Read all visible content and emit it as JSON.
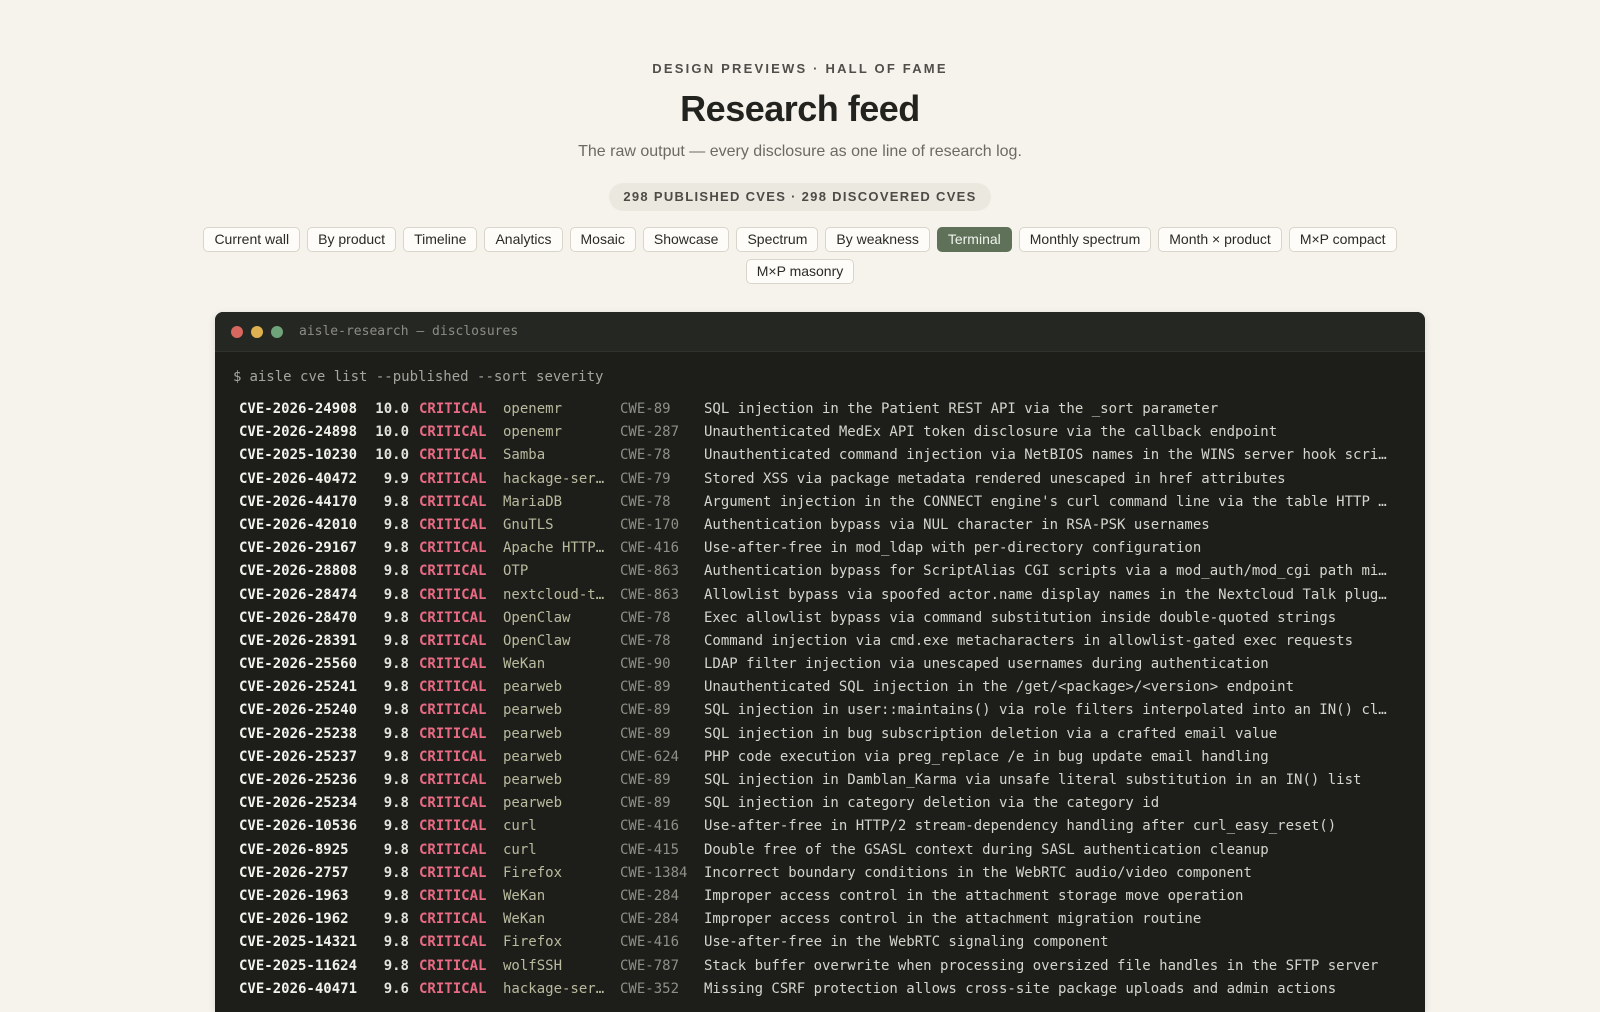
{
  "header": {
    "eyebrow": "DESIGN PREVIEWS · HALL OF FAME",
    "title": "Research feed",
    "subtitle": "The raw output — every disclosure as one line of research log.",
    "count_pill": "298 PUBLISHED CVES · 298 DISCOVERED CVES"
  },
  "nav": {
    "tabs": [
      {
        "label": "Current wall",
        "active": false
      },
      {
        "label": "By product",
        "active": false
      },
      {
        "label": "Timeline",
        "active": false
      },
      {
        "label": "Analytics",
        "active": false
      },
      {
        "label": "Mosaic",
        "active": false
      },
      {
        "label": "Showcase",
        "active": false
      },
      {
        "label": "Spectrum",
        "active": false
      },
      {
        "label": "By weakness",
        "active": false
      },
      {
        "label": "Terminal",
        "active": true
      },
      {
        "label": "Monthly spectrum",
        "active": false
      },
      {
        "label": "Month × product",
        "active": false
      },
      {
        "label": "M×P compact",
        "active": false
      },
      {
        "label": "M×P masonry",
        "active": false
      }
    ]
  },
  "terminal": {
    "title": "aisle-research — disclosures",
    "prompt": "$",
    "command": "aisle cve list --published --sort severity",
    "rows": [
      {
        "id": "CVE-2026-24908",
        "score": "10.0",
        "severity": "CRITICAL",
        "product": "openemr",
        "cwe": "CWE-89",
        "desc": "SQL injection in the Patient REST API via the _sort parameter"
      },
      {
        "id": "CVE-2026-24898",
        "score": "10.0",
        "severity": "CRITICAL",
        "product": "openemr",
        "cwe": "CWE-287",
        "desc": "Unauthenticated MedEx API token disclosure via the callback endpoint"
      },
      {
        "id": "CVE-2025-10230",
        "score": "10.0",
        "severity": "CRITICAL",
        "product": "Samba",
        "cwe": "CWE-78",
        "desc": "Unauthenticated command injection via NetBIOS names in the WINS server hook script"
      },
      {
        "id": "CVE-2026-40472",
        "score": "9.9",
        "severity": "CRITICAL",
        "product": "hackage-serv…",
        "cwe": "CWE-79",
        "desc": "Stored XSS via package metadata rendered unescaped in href attributes"
      },
      {
        "id": "CVE-2026-44170",
        "score": "9.8",
        "severity": "CRITICAL",
        "product": "MariaDB",
        "cwe": "CWE-78",
        "desc": "Argument injection in the CONNECT engine's curl command line via the table HTTP att…"
      },
      {
        "id": "CVE-2026-42010",
        "score": "9.8",
        "severity": "CRITICAL",
        "product": "GnuTLS",
        "cwe": "CWE-170",
        "desc": "Authentication bypass via NUL character in RSA-PSK usernames"
      },
      {
        "id": "CVE-2026-29167",
        "score": "9.8",
        "severity": "CRITICAL",
        "product": "Apache HTTP …",
        "cwe": "CWE-416",
        "desc": "Use-after-free in mod_ldap with per-directory configuration"
      },
      {
        "id": "CVE-2026-28808",
        "score": "9.8",
        "severity": "CRITICAL",
        "product": "OTP",
        "cwe": "CWE-863",
        "desc": "Authentication bypass for ScriptAlias CGI scripts via a mod_auth/mod_cgi path misma…"
      },
      {
        "id": "CVE-2026-28474",
        "score": "9.8",
        "severity": "CRITICAL",
        "product": "nextcloud-ta…",
        "cwe": "CWE-863",
        "desc": "Allowlist bypass via spoofed actor.name display names in the Nextcloud Talk plugin"
      },
      {
        "id": "CVE-2026-28470",
        "score": "9.8",
        "severity": "CRITICAL",
        "product": "OpenClaw",
        "cwe": "CWE-78",
        "desc": "Exec allowlist bypass via command substitution inside double-quoted strings"
      },
      {
        "id": "CVE-2026-28391",
        "score": "9.8",
        "severity": "CRITICAL",
        "product": "OpenClaw",
        "cwe": "CWE-78",
        "desc": "Command injection via cmd.exe metacharacters in allowlist-gated exec requests"
      },
      {
        "id": "CVE-2026-25560",
        "score": "9.8",
        "severity": "CRITICAL",
        "product": "WeKan",
        "cwe": "CWE-90",
        "desc": "LDAP filter injection via unescaped usernames during authentication"
      },
      {
        "id": "CVE-2026-25241",
        "score": "9.8",
        "severity": "CRITICAL",
        "product": "pearweb",
        "cwe": "CWE-89",
        "desc": "Unauthenticated SQL injection in the /get/<package>/<version> endpoint"
      },
      {
        "id": "CVE-2026-25240",
        "score": "9.8",
        "severity": "CRITICAL",
        "product": "pearweb",
        "cwe": "CWE-89",
        "desc": "SQL injection in user::maintains() via role filters interpolated into an IN() clause"
      },
      {
        "id": "CVE-2026-25238",
        "score": "9.8",
        "severity": "CRITICAL",
        "product": "pearweb",
        "cwe": "CWE-89",
        "desc": "SQL injection in bug subscription deletion via a crafted email value"
      },
      {
        "id": "CVE-2026-25237",
        "score": "9.8",
        "severity": "CRITICAL",
        "product": "pearweb",
        "cwe": "CWE-624",
        "desc": "PHP code execution via preg_replace /e in bug update email handling"
      },
      {
        "id": "CVE-2026-25236",
        "score": "9.8",
        "severity": "CRITICAL",
        "product": "pearweb",
        "cwe": "CWE-89",
        "desc": "SQL injection in Damblan_Karma via unsafe literal substitution in an IN() list"
      },
      {
        "id": "CVE-2026-25234",
        "score": "9.8",
        "severity": "CRITICAL",
        "product": "pearweb",
        "cwe": "CWE-89",
        "desc": "SQL injection in category deletion via the category id"
      },
      {
        "id": "CVE-2026-10536",
        "score": "9.8",
        "severity": "CRITICAL",
        "product": "curl",
        "cwe": "CWE-416",
        "desc": "Use-after-free in HTTP/2 stream-dependency handling after curl_easy_reset()"
      },
      {
        "id": "CVE-2026-8925",
        "score": "9.8",
        "severity": "CRITICAL",
        "product": "curl",
        "cwe": "CWE-415",
        "desc": "Double free of the GSASL context during SASL authentication cleanup"
      },
      {
        "id": "CVE-2026-2757",
        "score": "9.8",
        "severity": "CRITICAL",
        "product": "Firefox",
        "cwe": "CWE-1384",
        "desc": "Incorrect boundary conditions in the WebRTC audio/video component"
      },
      {
        "id": "CVE-2026-1963",
        "score": "9.8",
        "severity": "CRITICAL",
        "product": "WeKan",
        "cwe": "CWE-284",
        "desc": "Improper access control in the attachment storage move operation"
      },
      {
        "id": "CVE-2026-1962",
        "score": "9.8",
        "severity": "CRITICAL",
        "product": "WeKan",
        "cwe": "CWE-284",
        "desc": "Improper access control in the attachment migration routine"
      },
      {
        "id": "CVE-2025-14321",
        "score": "9.8",
        "severity": "CRITICAL",
        "product": "Firefox",
        "cwe": "CWE-416",
        "desc": "Use-after-free in the WebRTC signaling component"
      },
      {
        "id": "CVE-2025-11624",
        "score": "9.8",
        "severity": "CRITICAL",
        "product": "wolfSSH",
        "cwe": "CWE-787",
        "desc": "Stack buffer overwrite when processing oversized file handles in the SFTP server"
      },
      {
        "id": "CVE-2026-40471",
        "score": "9.6",
        "severity": "CRITICAL",
        "product": "hackage-serv…",
        "cwe": "CWE-352",
        "desc": "Missing CSRF protection allows cross-site package uploads and admin actions"
      }
    ]
  }
}
